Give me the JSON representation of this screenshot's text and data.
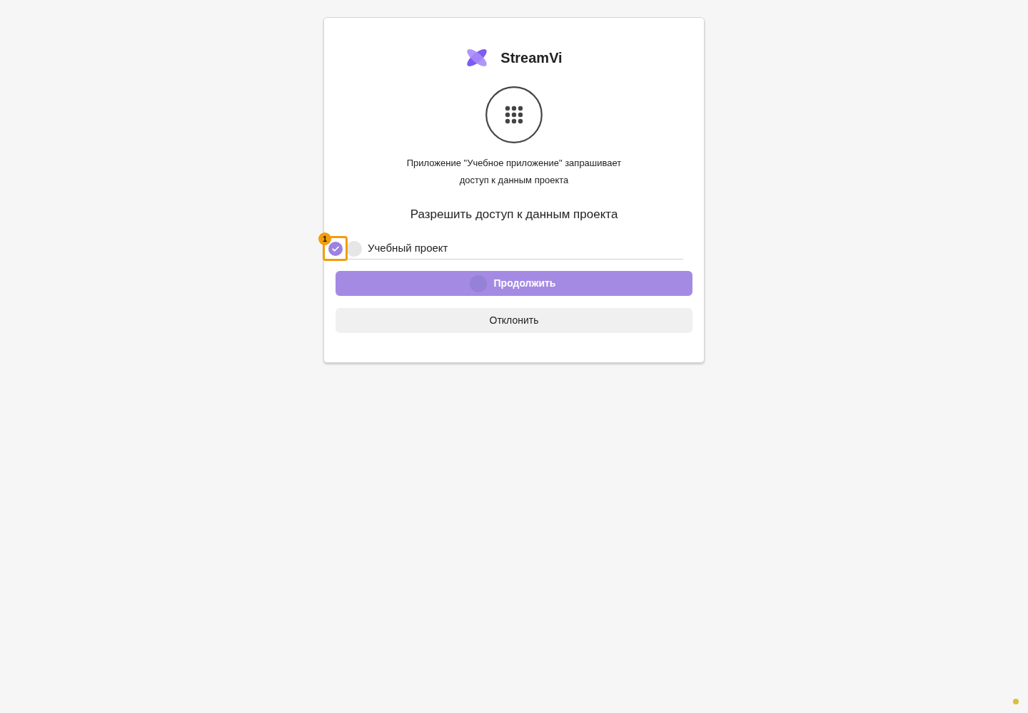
{
  "brand": {
    "name": "StreamVi"
  },
  "request": {
    "message_lines": [
      "Приложение \"Учебное приложение\" запрашивает",
      "доступ к данным проекта"
    ]
  },
  "heading": "Разрешить доступ к данным проекта",
  "projects": [
    {
      "label": "Учебный проект",
      "checked": true
    }
  ],
  "buttons": [
    {
      "label": "Продолжить",
      "kind": "primary"
    },
    {
      "label": "Отклонить",
      "kind": "secondary"
    }
  ],
  "annotation": {
    "label": "1"
  }
}
